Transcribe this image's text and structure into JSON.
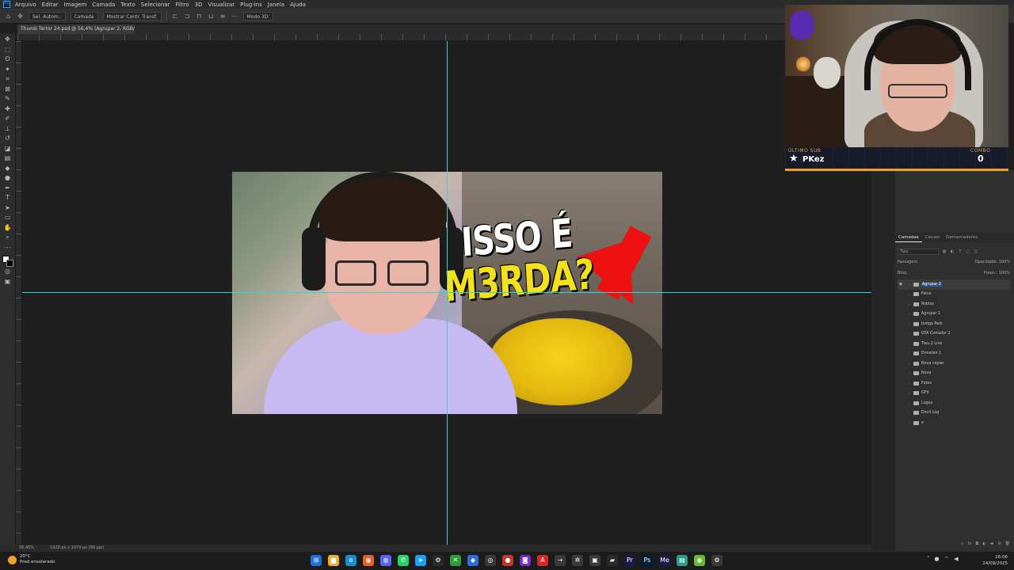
{
  "app": {
    "menu": [
      "Arquivo",
      "Editar",
      "Imagem",
      "Camada",
      "Texto",
      "Selecionar",
      "Filtro",
      "3D",
      "Visualizar",
      "Plug-ins",
      "Janela",
      "Ajuda"
    ]
  },
  "options": {
    "auto_select": "Sel. Autom.:",
    "target": "Camada",
    "transform": "Mostrar Contr. Transf.",
    "mode3d": "Modo 3D:"
  },
  "document": {
    "tab_title": "Thumb Terror 24.psd @ 56,4% (Agrupar 2, RGB/8) *",
    "zoom": "56,45%",
    "size": "1920 px x 1079 px (96 ppi)"
  },
  "thumbnail": {
    "headline_line1": "ISSO É",
    "headline_line2": "M3RDA?",
    "colors": {
      "line1": "#ffffff",
      "line2": "#f3e21a",
      "arrow": "#ee1111"
    }
  },
  "layers_panel": {
    "tabs": [
      "Camadas",
      "Canais",
      "Demarcadores"
    ],
    "filter_label": "Tipo",
    "blend_mode": "Passagem",
    "opacity_label": "Opacidade:",
    "opacity_value": "100%",
    "lock_label": "Bloq.:",
    "fill_label": "Preen.:",
    "fill_value": "100%",
    "layers": [
      {
        "name": "Agrupar 2",
        "selected": true
      },
      {
        "name": "Falca",
        "selected": false
      },
      {
        "name": "Roblox",
        "selected": false
      },
      {
        "name": "Agrupar 1",
        "selected": false
      },
      {
        "name": "Indigo Park",
        "selected": false
      },
      {
        "name": "GTA Cortador 2",
        "selected": false
      },
      {
        "name": "Tleu 2 Live",
        "selected": false
      },
      {
        "name": "Donaten 1",
        "selected": false
      },
      {
        "name": "Nova copiar",
        "selected": false
      },
      {
        "name": "Nova",
        "selected": false
      },
      {
        "name": "Fotos",
        "selected": false
      },
      {
        "name": "GFX",
        "selected": false
      },
      {
        "name": "Logos",
        "selected": false
      },
      {
        "name": "Devil Log",
        "selected": false
      },
      {
        "name": "e",
        "selected": false
      }
    ]
  },
  "stream_overlay": {
    "last_sub_label": "ÚLTIMO SUB",
    "last_sub_name": "PKez",
    "combo_label": "COMBO",
    "combo_value": "0"
  },
  "taskbar": {
    "temperature": "20°C",
    "weather": "Pred ensolarado",
    "time": "16:06",
    "date": "24/09/2025"
  }
}
